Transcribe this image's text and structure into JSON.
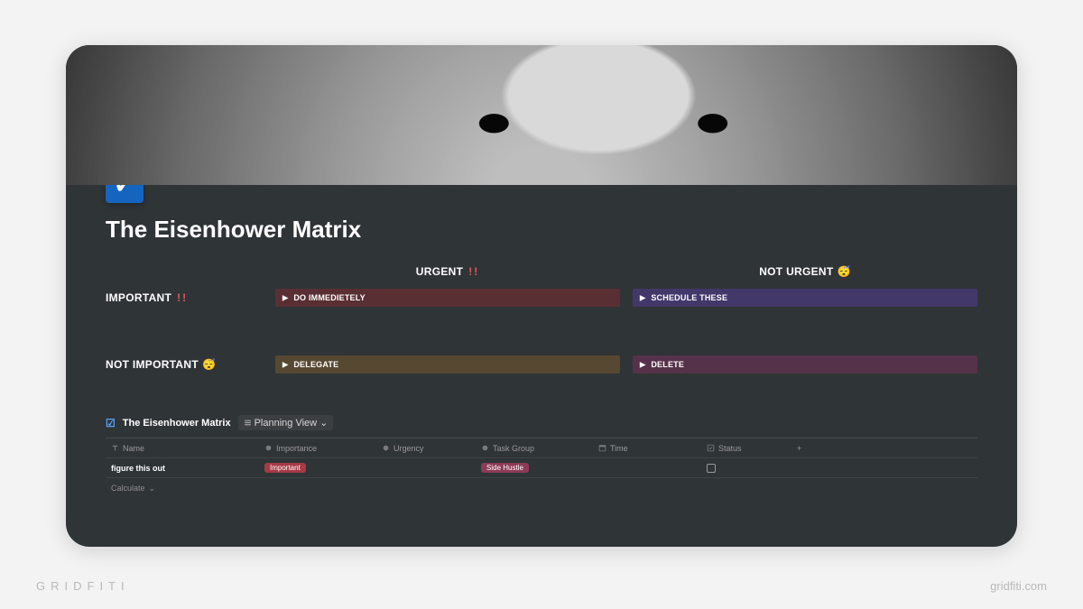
{
  "page": {
    "icon_glyph": "✓",
    "title": "The Eisenhower Matrix"
  },
  "matrix": {
    "col_headers": {
      "urgent": "URGENT",
      "not_urgent": "NOT URGENT"
    },
    "row_headers": {
      "important": "IMPORTANT",
      "not_important": "NOT IMPORTANT"
    },
    "marks": {
      "urgent": "!!",
      "not_urgent": "😴",
      "important": "!!",
      "not_important": "😴"
    },
    "cells": {
      "do": "DO IMMEDIETELY",
      "schedule": "SCHEDULE THESE",
      "delegate": "DELEGATE",
      "delete": "DELETE"
    }
  },
  "database": {
    "title": "The Eisenhower Matrix",
    "view_label": "Planning View",
    "columns": {
      "name": "Name",
      "importance": "Importance",
      "urgency": "Urgency",
      "task_group": "Task Group",
      "time": "Time",
      "status": "Status"
    },
    "rows": [
      {
        "name": "figure this out",
        "importance": "Important",
        "urgency": "",
        "task_group": "Side Hustle",
        "time": "",
        "status_checked": false
      }
    ],
    "calculate_label": "Calculate"
  },
  "branding": {
    "left": "GRIDFITI",
    "right": "gridfiti.com"
  },
  "glyphs": {
    "triangle": "▶",
    "chevron": "⌄",
    "plus": "+"
  }
}
